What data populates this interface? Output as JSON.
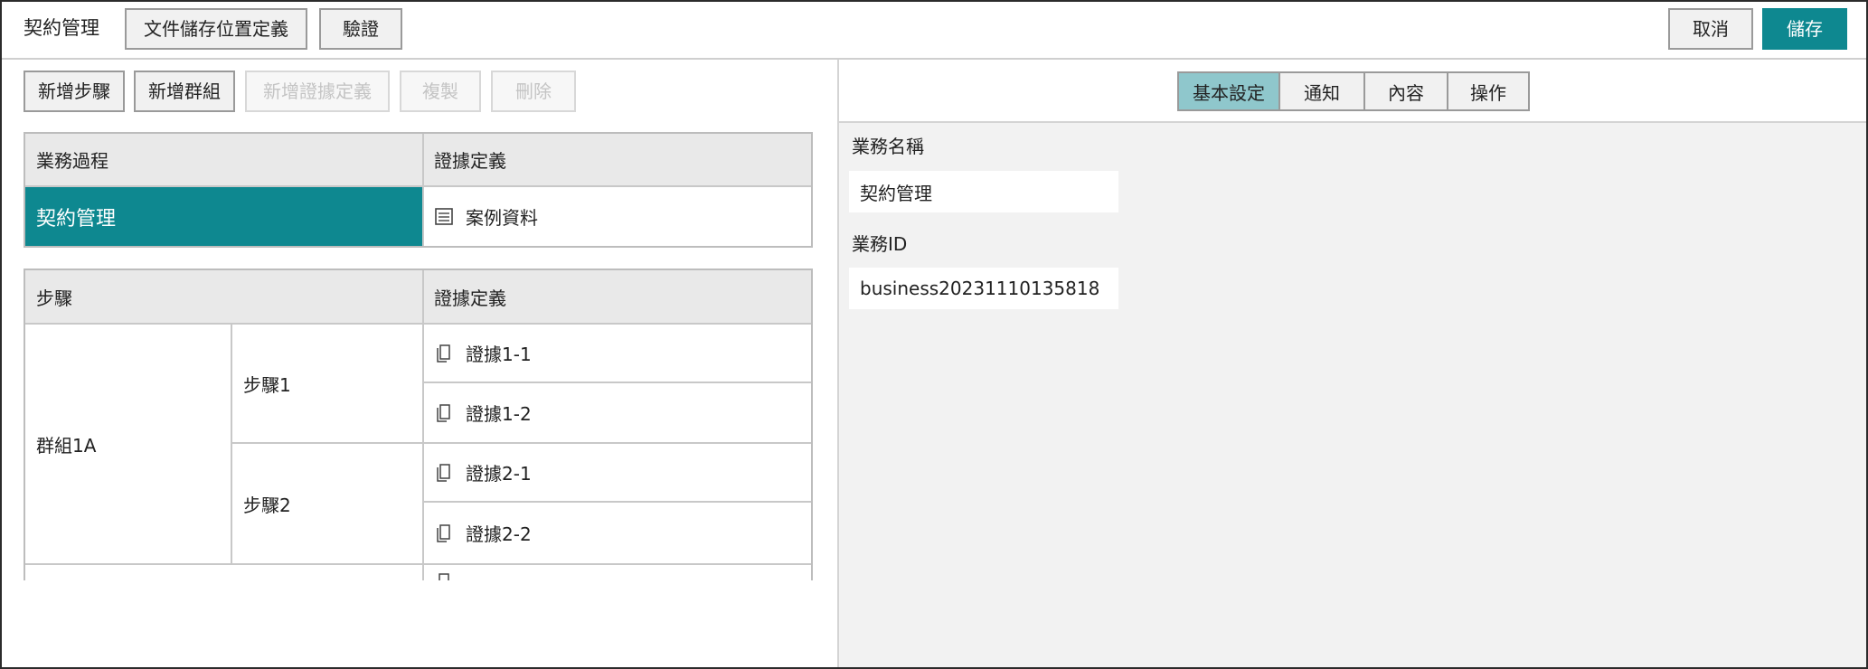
{
  "header": {
    "title": "契約管理",
    "btn_doc_location": "文件儲存位置定義",
    "btn_validate": "驗證",
    "btn_cancel": "取消",
    "btn_save": "儲存"
  },
  "toolbar": {
    "add_step": "新增步驟",
    "add_group": "新增群組",
    "add_evidence_def": "新增證據定義",
    "copy": "複製",
    "delete": "刪除"
  },
  "process_table": {
    "headers": [
      "業務過程",
      "證據定義"
    ],
    "row": {
      "process": "契約管理",
      "evidence": "案例資料"
    }
  },
  "steps_table": {
    "headers": [
      "步驟",
      "證據定義"
    ],
    "group": "群組1A",
    "steps": [
      {
        "name": "步驟1",
        "evidence": [
          "證據1-1",
          "證據1-2"
        ]
      },
      {
        "name": "步驟2",
        "evidence": [
          "證據2-1",
          "證據2-2"
        ]
      }
    ]
  },
  "tabs": [
    "基本設定",
    "通知",
    "內容",
    "操作"
  ],
  "form": {
    "name_label": "業務名稱",
    "name_value": "契約管理",
    "id_label": "業務ID",
    "id_value": "business20231110135818"
  },
  "colors": {
    "accent": "#0e8890",
    "active_tab": "#8fc7cc"
  },
  "icons": {
    "list": "list-icon",
    "document": "document-icon"
  }
}
